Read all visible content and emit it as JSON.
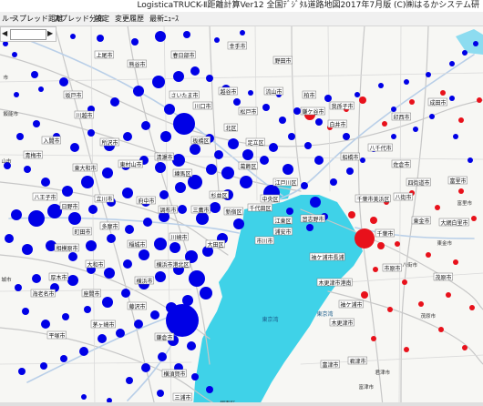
{
  "window": {
    "title": "LogisticaTRUCK-Ⅱ距離計算Ver12 全国ﾃﾞｼﾞﾀﾙ道路地図2017年7月版 (C)㈱はるかシステム研"
  },
  "menu": {
    "items": [
      {
        "label": "ルー"
      },
      {
        "label": "スプレッド距離"
      },
      {
        "label": "スプレッド分布"
      },
      {
        "label": "設定"
      },
      {
        "label": "変更履歴"
      },
      {
        "label": "最新ﾆｭｰｽ"
      }
    ]
  },
  "toolbar": {
    "back": "◀",
    "forward": "▶"
  },
  "map": {
    "colors": {
      "sea": "#3fd2e8",
      "land": "#f7f7f4",
      "road": "#c9c9c9",
      "road_major": "#9fbfe3",
      "blue_marker": "#0000e6",
      "red_marker": "#e8111b",
      "city_label_bg": "#ffffff"
    },
    "sea_labels": [
      {
        "text": "東京湾"
      },
      {
        "text": "東京湾"
      }
    ],
    "city_labels": [
      {
        "text": "上尾市"
      },
      {
        "text": "春日部市"
      },
      {
        "text": "幸手市"
      },
      {
        "text": "熊谷市"
      },
      {
        "text": "野田市"
      },
      {
        "text": "坂戸市"
      },
      {
        "text": "さいたま市"
      },
      {
        "text": "越谷市"
      },
      {
        "text": "松戸市"
      },
      {
        "text": "柏市"
      },
      {
        "text": "我孫子市"
      },
      {
        "text": "川越市"
      },
      {
        "text": "入間市"
      },
      {
        "text": "所沢市"
      },
      {
        "text": "川口市"
      },
      {
        "text": "流山市"
      },
      {
        "text": "鎌ケ谷市"
      },
      {
        "text": "印西市"
      },
      {
        "text": "成田市"
      },
      {
        "text": "白井市"
      },
      {
        "text": "青梅市"
      },
      {
        "text": "東大和市"
      },
      {
        "text": "東村山市"
      },
      {
        "text": "清瀬市"
      },
      {
        "text": "練馬区"
      },
      {
        "text": "板橋区"
      },
      {
        "text": "北区"
      },
      {
        "text": "足立区"
      },
      {
        "text": "葛飾区"
      },
      {
        "text": "江戸川区"
      },
      {
        "text": "船橋市"
      },
      {
        "text": "八千代市"
      },
      {
        "text": "佐倉市"
      },
      {
        "text": "四街道市"
      },
      {
        "text": "八王子市"
      },
      {
        "text": "日野市"
      },
      {
        "text": "立川市"
      },
      {
        "text": "府中市"
      },
      {
        "text": "調布市"
      },
      {
        "text": "三鷹市"
      },
      {
        "text": "杉並区"
      },
      {
        "text": "新宿区"
      },
      {
        "text": "千代田区"
      },
      {
        "text": "中央区"
      },
      {
        "text": "江東区"
      },
      {
        "text": "千葉市"
      },
      {
        "text": "千葉市美浜区"
      },
      {
        "text": "市原市"
      },
      {
        "text": "町田市"
      },
      {
        "text": "多摩市"
      },
      {
        "text": "稲城市"
      },
      {
        "text": "川崎市"
      },
      {
        "text": "大田区"
      },
      {
        "text": "相模原市"
      },
      {
        "text": "大和市"
      },
      {
        "text": "横浜市"
      },
      {
        "text": "横浜市港北区"
      },
      {
        "text": "厚木市"
      },
      {
        "text": "海老名市"
      },
      {
        "text": "座間市"
      },
      {
        "text": "藤沢市"
      },
      {
        "text": "茅ヶ崎市"
      },
      {
        "text": "平塚市"
      },
      {
        "text": "鎌倉市"
      },
      {
        "text": "横須賀市"
      },
      {
        "text": "三浦市"
      },
      {
        "text": "木更津市"
      },
      {
        "text": "君津市"
      },
      {
        "text": "袖ケ浦市"
      },
      {
        "text": "富津市"
      },
      {
        "text": "大網白里市"
      },
      {
        "text": "茂原市"
      },
      {
        "text": "東金市"
      },
      {
        "text": "八街市"
      },
      {
        "text": "富里市"
      },
      {
        "text": "市川市"
      },
      {
        "text": "浦安市"
      },
      {
        "text": "習志野市"
      },
      {
        "text": "木更津市港南"
      },
      {
        "text": "袖ケ浦市長浦"
      }
    ],
    "edge_labels": [
      {
        "text": "市"
      },
      {
        "text": "山市"
      },
      {
        "text": "飯能市"
      },
      {
        "text": "城市"
      },
      {
        "text": "大磯町"
      },
      {
        "text": "鋸南町"
      },
      {
        "text": "君津市"
      },
      {
        "text": "富津市"
      },
      {
        "text": "富里市"
      },
      {
        "text": "東金市"
      },
      {
        "text": "茂原市"
      },
      {
        "text": "八街市"
      }
    ]
  }
}
